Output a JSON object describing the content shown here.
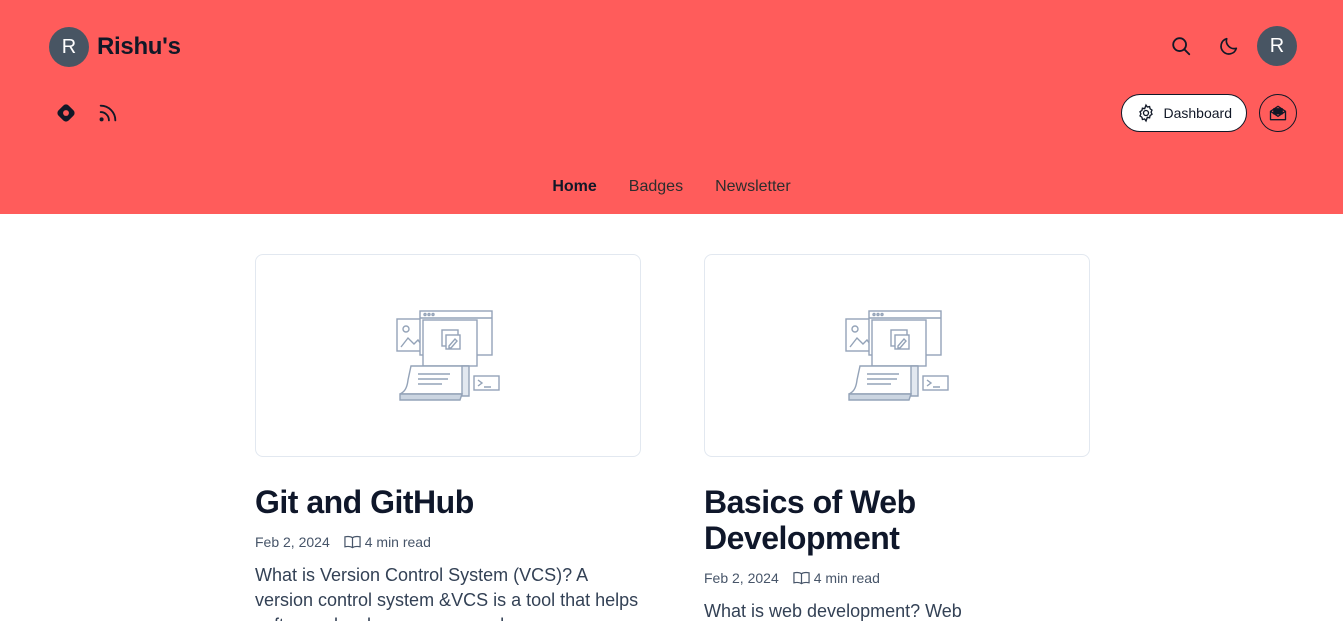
{
  "brand": {
    "avatar_letter": "R",
    "name": "Rishu's"
  },
  "top_actions": {
    "user_avatar_letter": "R",
    "icons": [
      "search-icon",
      "moon-icon"
    ]
  },
  "social_icons": [
    "hashnode-icon",
    "rss-icon"
  ],
  "dashboard": {
    "label": "Dashboard"
  },
  "nav": {
    "items": [
      {
        "label": "Home",
        "active": true
      },
      {
        "label": "Badges",
        "active": false
      },
      {
        "label": "Newsletter",
        "active": false
      }
    ]
  },
  "posts": [
    {
      "title": "Git and GitHub",
      "date": "Feb 2, 2024",
      "read_time": "4 min read",
      "excerpt": "What is Version Control System (VCS)? A version control system &VCS is a tool that helps software developers manage changes"
    },
    {
      "title": "Basics of Web Development",
      "date": "Feb 2, 2024",
      "read_time": "4 min read",
      "excerpt": "What is web development? Web"
    }
  ],
  "colors": {
    "header_bg": "#ff5c5b",
    "avatar_bg": "#485563",
    "text": "#0f172a"
  }
}
